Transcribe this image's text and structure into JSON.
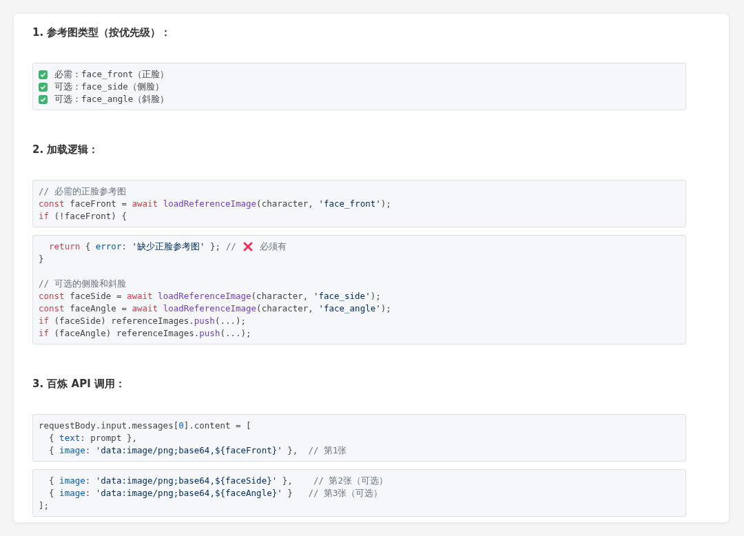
{
  "sections": [
    {
      "heading": "1. 参考图类型（按优先级）：",
      "checklist": [
        {
          "checked": true,
          "text": "必需：face_front（正脸）"
        },
        {
          "checked": true,
          "text": "可选：face_side（侧脸）"
        },
        {
          "checked": true,
          "text": "可选：face_angle（斜脸）"
        }
      ]
    },
    {
      "heading": "2. 加载逻辑：",
      "code_blocks": [
        {
          "lines": [
            {
              "kind": "code",
              "tokens": [
                {
                  "kind": "comment",
                  "text": "// 必需的正脸参考图"
                }
              ]
            },
            {
              "kind": "code",
              "tokens": [
                {
                  "kind": "keyword",
                  "text": "const"
                },
                {
                  "kind": "plain",
                  "text": " faceFront = "
                },
                {
                  "kind": "keyword",
                  "text": "await "
                },
                {
                  "kind": "function",
                  "text": "loadReferenceImage"
                },
                {
                  "kind": "plain",
                  "text": "(character, "
                },
                {
                  "kind": "string",
                  "text": "'face_front'"
                },
                {
                  "kind": "plain",
                  "text": ");"
                }
              ]
            },
            {
              "kind": "code",
              "tokens": [
                {
                  "kind": "keyword",
                  "text": "if"
                },
                {
                  "kind": "plain",
                  "text": " (!faceFront) {"
                }
              ]
            }
          ]
        },
        {
          "lines": [
            {
              "kind": "code",
              "tokens": [
                {
                  "kind": "keyword",
                  "text": "  return"
                },
                {
                  "kind": "plain",
                  "text": " { "
                },
                {
                  "kind": "property",
                  "text": "error"
                },
                {
                  "kind": "plain",
                  "text": ": "
                },
                {
                  "kind": "string",
                  "text": "'缺少正脸参考图'"
                },
                {
                  "kind": "plain",
                  "text": " }; "
                },
                {
                  "kind": "comment",
                  "text": "//"
                },
                {
                  "kind": "cross"
                },
                {
                  "kind": "comment",
                  "text": "必须有"
                }
              ]
            },
            {
              "kind": "code",
              "tokens": [
                {
                  "kind": "plain",
                  "text": "}"
                }
              ]
            },
            {
              "kind": "blank"
            },
            {
              "kind": "code",
              "tokens": [
                {
                  "kind": "comment",
                  "text": "// 可选的侧脸和斜脸"
                }
              ]
            },
            {
              "kind": "code",
              "tokens": [
                {
                  "kind": "keyword",
                  "text": "const"
                },
                {
                  "kind": "plain",
                  "text": " faceSide = "
                },
                {
                  "kind": "keyword",
                  "text": "await "
                },
                {
                  "kind": "function",
                  "text": "loadReferenceImage"
                },
                {
                  "kind": "plain",
                  "text": "(character, "
                },
                {
                  "kind": "string",
                  "text": "'face_side'"
                },
                {
                  "kind": "plain",
                  "text": ");"
                }
              ]
            },
            {
              "kind": "code",
              "tokens": [
                {
                  "kind": "keyword",
                  "text": "const"
                },
                {
                  "kind": "plain",
                  "text": " faceAngle = "
                },
                {
                  "kind": "keyword",
                  "text": "await "
                },
                {
                  "kind": "function",
                  "text": "loadReferenceImage"
                },
                {
                  "kind": "plain",
                  "text": "(character, "
                },
                {
                  "kind": "string",
                  "text": "'face_angle'"
                },
                {
                  "kind": "plain",
                  "text": ");"
                }
              ]
            },
            {
              "kind": "code",
              "tokens": [
                {
                  "kind": "keyword",
                  "text": "if"
                },
                {
                  "kind": "plain",
                  "text": " (faceSide) referenceImages."
                },
                {
                  "kind": "function",
                  "text": "push"
                },
                {
                  "kind": "plain",
                  "text": "(...);"
                }
              ]
            },
            {
              "kind": "code",
              "tokens": [
                {
                  "kind": "keyword",
                  "text": "if"
                },
                {
                  "kind": "plain",
                  "text": " (faceAngle) referenceImages."
                },
                {
                  "kind": "function",
                  "text": "push"
                },
                {
                  "kind": "plain",
                  "text": "(...);"
                }
              ]
            }
          ]
        }
      ]
    },
    {
      "heading": "3. 百炼 API 调用：",
      "code_blocks": [
        {
          "lines": [
            {
              "kind": "code",
              "tokens": [
                {
                  "kind": "plain",
                  "text": "requestBody.input.messages["
                },
                {
                  "kind": "number",
                  "text": "0"
                },
                {
                  "kind": "plain",
                  "text": "].content = ["
                }
              ]
            },
            {
              "kind": "code",
              "tokens": [
                {
                  "kind": "plain",
                  "text": "  { "
                },
                {
                  "kind": "property",
                  "text": "text"
                },
                {
                  "kind": "plain",
                  "text": ": prompt },"
                }
              ]
            },
            {
              "kind": "code",
              "tokens": [
                {
                  "kind": "plain",
                  "text": "  { "
                },
                {
                  "kind": "property",
                  "text": "image"
                },
                {
                  "kind": "plain",
                  "text": ": "
                },
                {
                  "kind": "string",
                  "text": "'data:image/png;base64,${faceFront}'"
                },
                {
                  "kind": "plain",
                  "text": " },  "
                },
                {
                  "kind": "comment",
                  "text": "// 第1张"
                }
              ]
            }
          ]
        },
        {
          "lines": [
            {
              "kind": "code",
              "tokens": [
                {
                  "kind": "plain",
                  "text": "  { "
                },
                {
                  "kind": "property",
                  "text": "image"
                },
                {
                  "kind": "plain",
                  "text": ": "
                },
                {
                  "kind": "string",
                  "text": "'data:image/png;base64,${faceSide}'"
                },
                {
                  "kind": "plain",
                  "text": " },    "
                },
                {
                  "kind": "comment",
                  "text": "// 第2张（可选）"
                }
              ]
            },
            {
              "kind": "code",
              "tokens": [
                {
                  "kind": "plain",
                  "text": "  { "
                },
                {
                  "kind": "property",
                  "text": "image"
                },
                {
                  "kind": "plain",
                  "text": ": "
                },
                {
                  "kind": "string",
                  "text": "'data:image/png;base64,${faceAngle}'"
                },
                {
                  "kind": "plain",
                  "text": " }   "
                },
                {
                  "kind": "comment",
                  "text": "// 第3张（可选）"
                }
              ]
            },
            {
              "kind": "code",
              "tokens": [
                {
                  "kind": "plain",
                  "text": "];"
                }
              ]
            }
          ]
        }
      ]
    }
  ]
}
